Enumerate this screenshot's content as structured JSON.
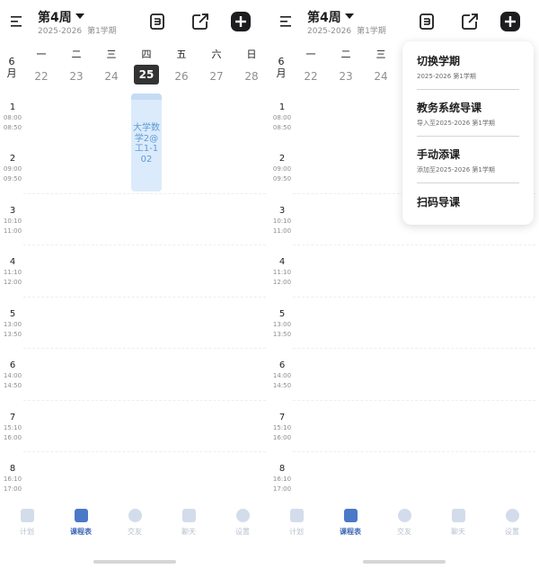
{
  "header": {
    "week": "第4周",
    "term_year": "2025-2026",
    "term_semester": "第1学期"
  },
  "date_row": {
    "month": "6\n月",
    "days": [
      {
        "weekday": "一",
        "date": "22"
      },
      {
        "weekday": "二",
        "date": "23"
      },
      {
        "weekday": "三",
        "date": "24"
      },
      {
        "weekday": "四",
        "date": "25",
        "today": true
      },
      {
        "weekday": "五",
        "date": "26"
      },
      {
        "weekday": "六",
        "date": "27"
      },
      {
        "weekday": "日",
        "date": "28"
      }
    ]
  },
  "slots": [
    {
      "n": "1",
      "start": "08:00",
      "end": "08:50"
    },
    {
      "n": "2",
      "start": "09:00",
      "end": "09:50"
    },
    {
      "n": "3",
      "start": "10:10",
      "end": "11:00"
    },
    {
      "n": "4",
      "start": "11:10",
      "end": "12:00"
    },
    {
      "n": "5",
      "start": "13:00",
      "end": "13:50"
    },
    {
      "n": "6",
      "start": "14:00",
      "end": "14:50"
    },
    {
      "n": "7",
      "start": "15:10",
      "end": "16:00"
    },
    {
      "n": "8",
      "start": "16:10",
      "end": "17:00"
    }
  ],
  "course": {
    "text": "大学数学2@工1-102"
  },
  "nav": [
    {
      "label": "计划"
    },
    {
      "label": "课程表",
      "active": true
    },
    {
      "label": "交友"
    },
    {
      "label": "聊天"
    },
    {
      "label": "设置"
    }
  ],
  "add_menu": {
    "items": [
      {
        "title": "切换学期",
        "sub": "2025-2026 第1学期"
      },
      {
        "title": "教务系统导课",
        "sub": "导入至2025-2026 第1学期"
      },
      {
        "title": "手动添课",
        "sub": "添加至2025-2026 第1学期"
      },
      {
        "title": "扫码导课",
        "sub": ""
      }
    ]
  },
  "colors": {
    "accent": "#4a79c8",
    "course_bg": "#dcebfb",
    "course_text": "#5b9bd8",
    "today_bg": "#333333"
  }
}
